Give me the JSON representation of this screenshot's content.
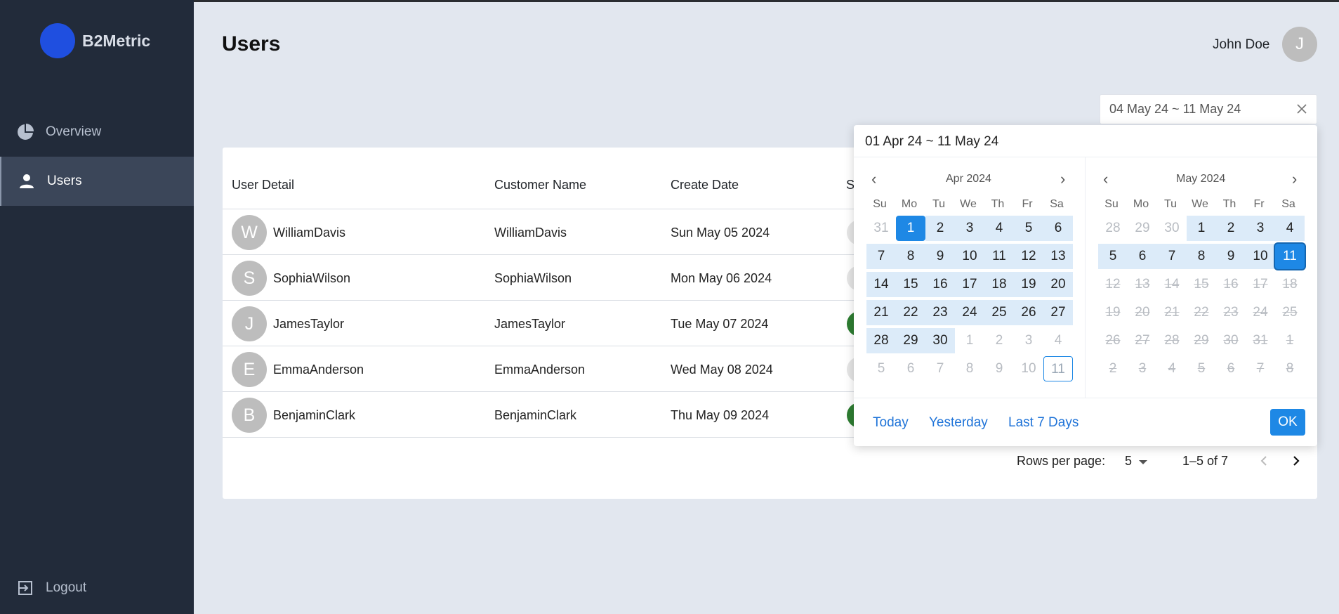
{
  "brand": {
    "name": "B2Metric"
  },
  "sidebar": {
    "items": [
      {
        "label": "Overview",
        "icon": "pie-chart-icon"
      },
      {
        "label": "Users",
        "icon": "person-icon"
      }
    ],
    "logout": {
      "label": "Logout",
      "icon": "logout-icon"
    }
  },
  "header": {
    "title": "Users",
    "user_name": "John Doe",
    "user_initial": "J"
  },
  "date_filter": {
    "value": "04 May 24 ~ 11 May 24"
  },
  "table": {
    "columns": [
      "User Detail",
      "Customer Name",
      "Create Date",
      "S"
    ],
    "rows": [
      {
        "initial": "W",
        "user": "WilliamDavis",
        "customer": "WilliamDavis",
        "date": "Sun May 05 2024",
        "status": "grey"
      },
      {
        "initial": "S",
        "user": "SophiaWilson",
        "customer": "SophiaWilson",
        "date": "Mon May 06 2024",
        "status": "grey"
      },
      {
        "initial": "J",
        "user": "JamesTaylor",
        "customer": "JamesTaylor",
        "date": "Tue May 07 2024",
        "status": "green"
      },
      {
        "initial": "E",
        "user": "EmmaAnderson",
        "customer": "EmmaAnderson",
        "date": "Wed May 08 2024",
        "status": "grey"
      },
      {
        "initial": "B",
        "user": "BenjaminClark",
        "customer": "BenjaminClark",
        "date": "Thu May 09 2024",
        "status": "green"
      }
    ],
    "pagination": {
      "rows_label": "Rows per page:",
      "rows_value": "5",
      "range": "1–5 of 7"
    }
  },
  "picker": {
    "range": "01 Apr 24 ~ 11 May 24",
    "weekdays": [
      "Su",
      "Mo",
      "Tu",
      "We",
      "Th",
      "Fr",
      "Sa"
    ],
    "left": {
      "title": "Apr 2024",
      "days": [
        [
          "31",
          "m"
        ],
        [
          "1",
          "s"
        ],
        [
          "2",
          "r"
        ],
        [
          "3",
          "r"
        ],
        [
          "4",
          "r"
        ],
        [
          "5",
          "r"
        ],
        [
          "6",
          "r"
        ],
        [
          "7",
          "r"
        ],
        [
          "8",
          "r"
        ],
        [
          "9",
          "r"
        ],
        [
          "10",
          "r"
        ],
        [
          "11",
          "r"
        ],
        [
          "12",
          "r"
        ],
        [
          "13",
          "r"
        ],
        [
          "14",
          "r"
        ],
        [
          "15",
          "r"
        ],
        [
          "16",
          "r"
        ],
        [
          "17",
          "r"
        ],
        [
          "18",
          "r"
        ],
        [
          "19",
          "r"
        ],
        [
          "20",
          "r"
        ],
        [
          "21",
          "r"
        ],
        [
          "22",
          "r"
        ],
        [
          "23",
          "r"
        ],
        [
          "24",
          "r"
        ],
        [
          "25",
          "r"
        ],
        [
          "26",
          "r"
        ],
        [
          "27",
          "r"
        ],
        [
          "28",
          "r"
        ],
        [
          "29",
          "r"
        ],
        [
          "30",
          "r"
        ],
        [
          "1",
          "m"
        ],
        [
          "2",
          "m"
        ],
        [
          "3",
          "m"
        ],
        [
          "4",
          "m"
        ],
        [
          "5",
          "m"
        ],
        [
          "6",
          "m"
        ],
        [
          "7",
          "m"
        ],
        [
          "8",
          "m"
        ],
        [
          "9",
          "m"
        ],
        [
          "10",
          "m"
        ],
        [
          "11",
          "t"
        ]
      ]
    },
    "right": {
      "title": "May 2024",
      "days": [
        [
          "28",
          "m"
        ],
        [
          "29",
          "m"
        ],
        [
          "30",
          "m"
        ],
        [
          "1",
          "r"
        ],
        [
          "2",
          "r"
        ],
        [
          "3",
          "r"
        ],
        [
          "4",
          "r"
        ],
        [
          "5",
          "r"
        ],
        [
          "6",
          "r"
        ],
        [
          "7",
          "r"
        ],
        [
          "8",
          "r"
        ],
        [
          "9",
          "r"
        ],
        [
          "10",
          "r"
        ],
        [
          "11",
          "s"
        ],
        [
          "12",
          "x"
        ],
        [
          "13",
          "x"
        ],
        [
          "14",
          "x"
        ],
        [
          "15",
          "x"
        ],
        [
          "16",
          "x"
        ],
        [
          "17",
          "x"
        ],
        [
          "18",
          "x"
        ],
        [
          "19",
          "x"
        ],
        [
          "20",
          "x"
        ],
        [
          "21",
          "x"
        ],
        [
          "22",
          "x"
        ],
        [
          "23",
          "x"
        ],
        [
          "24",
          "x"
        ],
        [
          "25",
          "x"
        ],
        [
          "26",
          "x"
        ],
        [
          "27",
          "x"
        ],
        [
          "28",
          "x"
        ],
        [
          "29",
          "x"
        ],
        [
          "30",
          "x"
        ],
        [
          "31",
          "x"
        ],
        [
          "1",
          "x"
        ],
        [
          "2",
          "x"
        ],
        [
          "3",
          "x"
        ],
        [
          "4",
          "x"
        ],
        [
          "5",
          "x"
        ],
        [
          "6",
          "x"
        ],
        [
          "7",
          "x"
        ],
        [
          "8",
          "x"
        ]
      ]
    },
    "shortcuts": [
      "Today",
      "Yesterday",
      "Last 7 Days"
    ],
    "ok_label": "OK"
  },
  "colors": {
    "accent": "#1e88e5",
    "sidebar": "#222b3a",
    "brand_logo": "#1f4fe0",
    "status_green": "#2e7d32"
  }
}
